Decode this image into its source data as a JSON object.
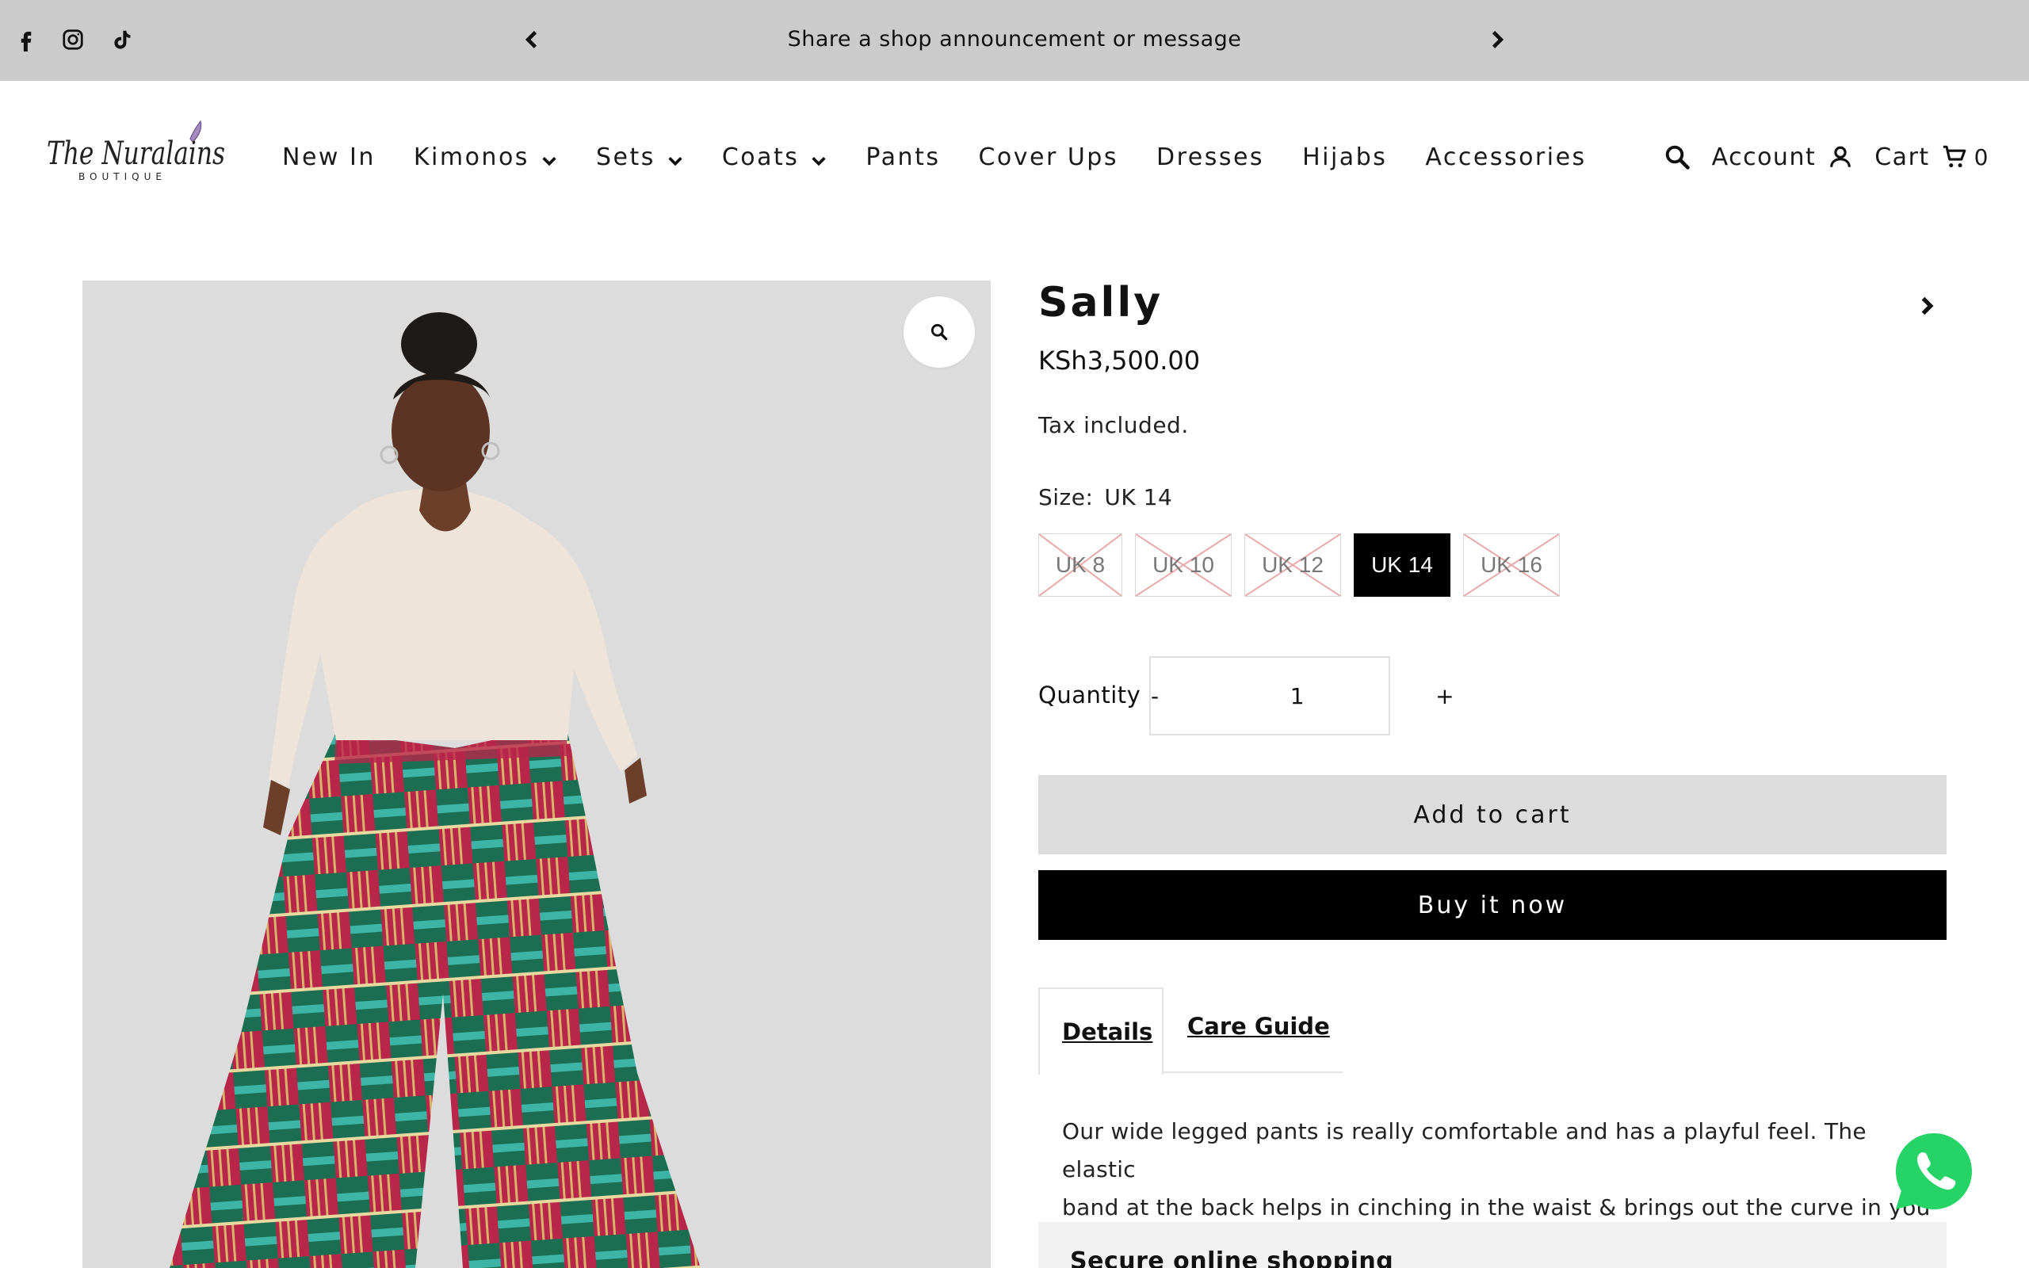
{
  "announcement": {
    "text": "Share a shop announcement or message",
    "social_icons": [
      "facebook-icon",
      "instagram-icon",
      "tiktok-icon"
    ]
  },
  "brand": {
    "logo_script": "The Nuralains",
    "logo_sub": "BOUTIQUE",
    "accent_color": "#8a6aa8"
  },
  "nav": {
    "items": [
      {
        "label": "New In",
        "has_dropdown": false
      },
      {
        "label": "Kimonos",
        "has_dropdown": true
      },
      {
        "label": "Sets",
        "has_dropdown": true
      },
      {
        "label": "Coats",
        "has_dropdown": true
      },
      {
        "label": "Pants",
        "has_dropdown": false
      },
      {
        "label": "Cover Ups",
        "has_dropdown": false
      },
      {
        "label": "Dresses",
        "has_dropdown": false
      },
      {
        "label": "Hijabs",
        "has_dropdown": false
      },
      {
        "label": "Accessories",
        "has_dropdown": false
      }
    ]
  },
  "header": {
    "account_label": "Account",
    "cart_label": "Cart",
    "cart_count": "0"
  },
  "product": {
    "title": "Sally",
    "price": "KSh3,500.00",
    "tax_note": "Tax included.",
    "size_label": "Size:",
    "selected_size": "UK 14",
    "sizes": [
      {
        "label": "UK 8",
        "sold_out": true
      },
      {
        "label": "UK 10",
        "sold_out": true
      },
      {
        "label": "UK 12",
        "sold_out": true
      },
      {
        "label": "UK 14",
        "sold_out": false,
        "selected": true
      },
      {
        "label": "UK 16",
        "sold_out": true
      }
    ],
    "quantity_label": "Quantity",
    "quantity_value": "1",
    "qty_minus": "-",
    "qty_plus": "+",
    "add_to_cart_label": "Add to cart",
    "buy_now_label": "Buy it now"
  },
  "tabs": {
    "details_label": "Details",
    "care_label": "Care Guide"
  },
  "description": {
    "line1": "Our wide legged pants is really comfortable and has a playful feel.  The elastic",
    "line2": "band at the back  helps in cinching in the waist & brings out the curve in you"
  },
  "secure": {
    "label": "Secure online shopping"
  },
  "colors": {
    "announcement_bg": "#cbcbcb",
    "image_bg": "#dcdcdc",
    "add_to_cart_bg": "#dcdcdc",
    "buy_now_bg": "#000000",
    "whatsapp_green": "#25d366",
    "pant_red": "#b8264a",
    "pant_green": "#1b6e52",
    "pant_teal": "#3cb5a6"
  }
}
